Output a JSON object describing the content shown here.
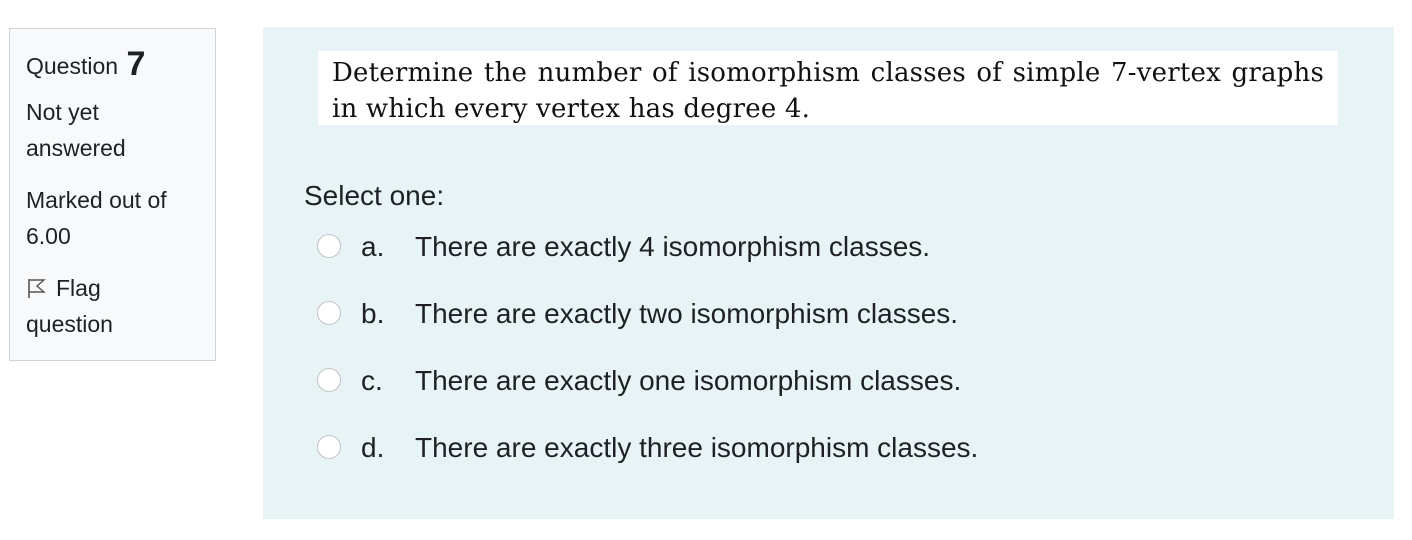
{
  "info": {
    "question_label": "Question",
    "question_number": "7",
    "state_line1": "Not yet",
    "state_line2": "answered",
    "grade_line1": "Marked out of",
    "grade_line2": "6.00",
    "flag_line1": "Flag",
    "flag_line2": "question",
    "flag_icon": "flag-icon"
  },
  "question": {
    "text": "Determine the number of isomorphism classes of simple 7-vertex graphs in which every vertex has degree 4."
  },
  "prompt": "Select one:",
  "answers": [
    {
      "letter": "a.",
      "text": "There are exactly 4 isomorphism classes."
    },
    {
      "letter": "b.",
      "text": "There are exactly two isomorphism classes."
    },
    {
      "letter": "c.",
      "text": "There are exactly one isomorphism classes."
    },
    {
      "letter": "d.",
      "text": "There are exactly three isomorphism classes."
    }
  ]
}
